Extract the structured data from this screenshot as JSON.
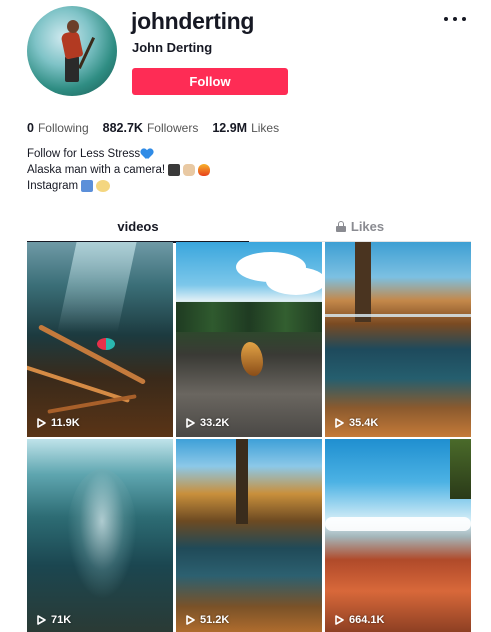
{
  "profile": {
    "username": "johnderting",
    "display_name": "John Derting",
    "follow_label": "Follow"
  },
  "stats": {
    "following_count": "0",
    "following_label": "Following",
    "followers_count": "882.7K",
    "followers_label": "Followers",
    "likes_count": "12.9M",
    "likes_label": "Likes"
  },
  "bio": {
    "line1": "Follow for Less Stress",
    "line2": "Alaska man with a camera!",
    "line3": "Instagram"
  },
  "tabs": {
    "videos_label": "videos",
    "likes_label": "Likes"
  },
  "videos": [
    {
      "views": "11.9K"
    },
    {
      "views": "33.2K"
    },
    {
      "views": "35.4K"
    },
    {
      "views": "71K"
    },
    {
      "views": "51.2K"
    },
    {
      "views": "664.1K"
    }
  ],
  "colors": {
    "follow_button": "#fe2c55",
    "heart_emoji": "#2f8be6"
  },
  "icons": [
    "more-options-icon",
    "blue-heart-emoji",
    "movie-camera-emoji",
    "fist-emoji",
    "fire-emoji",
    "down-arrow-emoji",
    "lock-icon",
    "play-icon"
  ]
}
